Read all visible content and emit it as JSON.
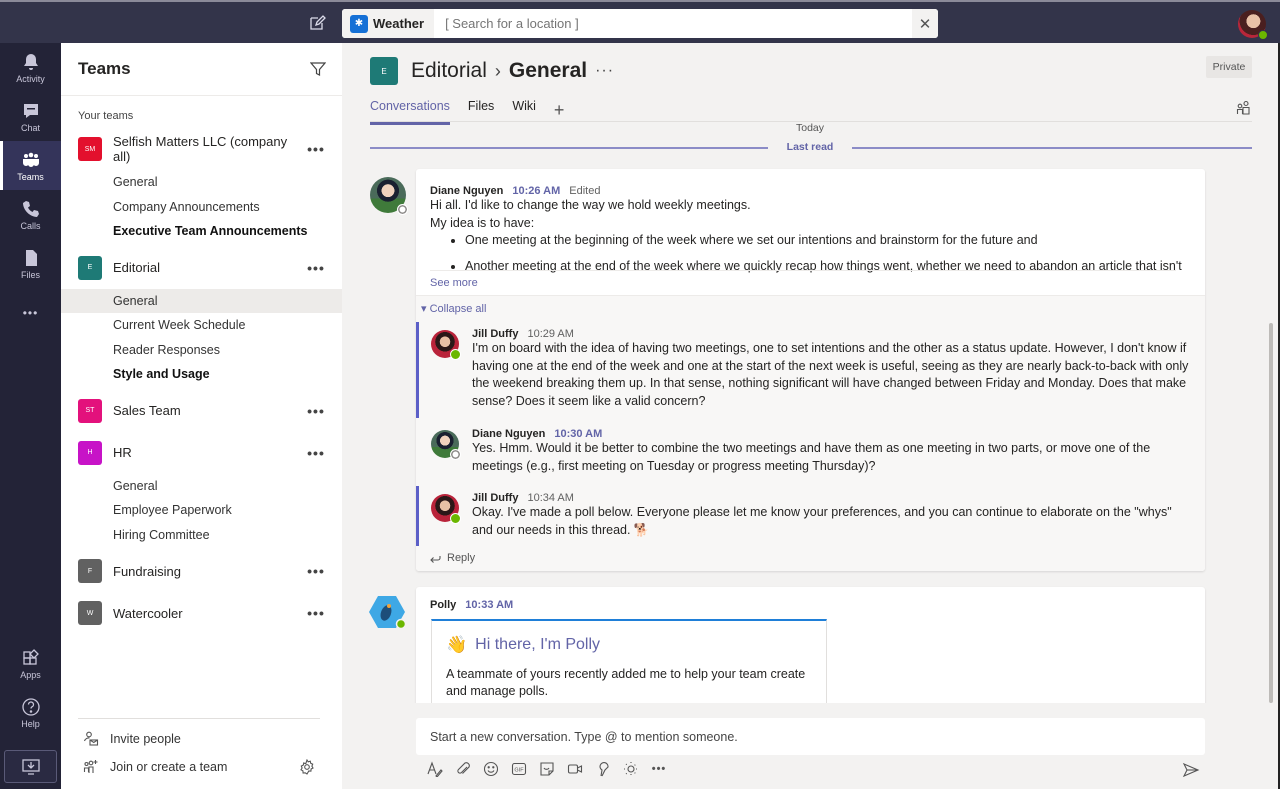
{
  "titlebar": {
    "app_name": "Weather",
    "search_placeholder": "[ Search for a location ]",
    "clear_label": "✕",
    "compose_icon": "new-chat-icon",
    "user_status": "available"
  },
  "rail": {
    "items": [
      {
        "label": "Activity",
        "icon": "bell-icon"
      },
      {
        "label": "Chat",
        "icon": "chat-icon"
      },
      {
        "label": "Teams",
        "icon": "teams-icon",
        "active": true
      },
      {
        "label": "Calls",
        "icon": "phone-icon"
      },
      {
        "label": "Files",
        "icon": "file-icon"
      },
      {
        "label": "•••",
        "icon": "more-icon"
      }
    ],
    "bottom": [
      {
        "label": "Apps",
        "icon": "apps-icon"
      },
      {
        "label": "Help",
        "icon": "help-icon"
      }
    ],
    "download_icon": "download-icon"
  },
  "teams_panel": {
    "title": "Teams",
    "section_label": "Your teams",
    "teams": [
      {
        "initials": "SM",
        "name": "Selfish Matters LLC (company all)",
        "color": "#e3102d",
        "channels": [
          {
            "name": "General"
          },
          {
            "name": "Company Announcements"
          },
          {
            "name": "Executive Team Announcements",
            "bold": true
          }
        ]
      },
      {
        "initials": "E",
        "name": "Editorial",
        "color": "#1e7a76",
        "channels": [
          {
            "name": "General",
            "active": true
          },
          {
            "name": "Current Week Schedule"
          },
          {
            "name": "Reader Responses"
          },
          {
            "name": "Style and Usage",
            "bold": true
          }
        ]
      },
      {
        "initials": "ST",
        "name": "Sales Team",
        "color": "#e3117c",
        "channels": []
      },
      {
        "initials": "H",
        "name": "HR",
        "color": "#c713c7",
        "channels": [
          {
            "name": "General"
          },
          {
            "name": "Employee Paperwork"
          },
          {
            "name": "Hiring Committee"
          }
        ]
      },
      {
        "initials": "F",
        "name": "Fundraising",
        "color": "#616161",
        "channels": []
      },
      {
        "initials": "W",
        "name": "Watercooler",
        "color": "#616161",
        "channels": []
      }
    ],
    "more_label": "•••",
    "footer": {
      "invite": "Invite people",
      "join": "Join or create a team"
    }
  },
  "channel": {
    "team_initial": "E",
    "team": "Editorial",
    "separator": "›",
    "name": "General",
    "more": "···",
    "privacy": "Private",
    "tabs": [
      {
        "label": "Conversations",
        "active": true
      },
      {
        "label": "Files"
      },
      {
        "label": "Wiki"
      }
    ],
    "add_tab": "+",
    "today_label": "Today",
    "last_read_label": "Last read"
  },
  "thread": {
    "root": {
      "author": "Diane Nguyen",
      "time": "10:26 AM",
      "edited": "Edited",
      "lines": [
        "Hi all. I'd like to change the way we hold weekly meetings.",
        "My idea is to have:"
      ],
      "bullets": [
        "One meeting at the beginning of the week where we set our intentions and brainstorm for the future and",
        "Another meeting at the end of the week where we quickly recap how things went, whether we need to abandon an article that isn't"
      ],
      "see_more": "See more",
      "status": "away"
    },
    "collapse_all": "Collapse all",
    "replies": [
      {
        "author": "Jill Duffy",
        "time": "10:29 AM",
        "status": "online",
        "text": "I'm on board with the idea of having two meetings, one to set intentions and the other as a status update. However, I don't know if having one at the end of the week and one at the start of the next week is useful, seeing as they are nearly back-to-back with only the weekend breaking them up. In that sense, nothing significant will have changed between Friday and Monday. Does that make sense? Does it seem like a valid concern?"
      },
      {
        "author": "Diane Nguyen",
        "time": "10:30 AM",
        "status": "away",
        "unread": true,
        "text": "Yes. Hmm. Would it be better to combine the two meetings and have them as one meeting in two parts, or move one of the meetings (e.g., first meeting on Tuesday or progress meeting Thursday)?"
      },
      {
        "author": "Jill Duffy",
        "time": "10:34 AM",
        "status": "online",
        "text": "Okay. I've made a poll below. Everyone please let me know your preferences, and you can continue to elaborate on the \"whys\" and our needs in this thread. 🐕"
      }
    ],
    "reply_label": "Reply"
  },
  "polly": {
    "author": "Polly",
    "time": "10:33 AM",
    "card_title": "Hi there, I'm Polly",
    "card_emoji": "👋",
    "card_text": "A teammate of yours recently added me to help your team create and manage polls."
  },
  "compose": {
    "placeholder": "Start a new conversation. Type @ to mention someone.",
    "tools": [
      "format-icon",
      "attach-icon",
      "emoji-icon",
      "gif-icon",
      "sticker-icon",
      "meet-now-icon",
      "polly-icon",
      "praise-icon",
      "more-options-icon"
    ],
    "gif_label": "GIF",
    "more_label": "•••"
  }
}
